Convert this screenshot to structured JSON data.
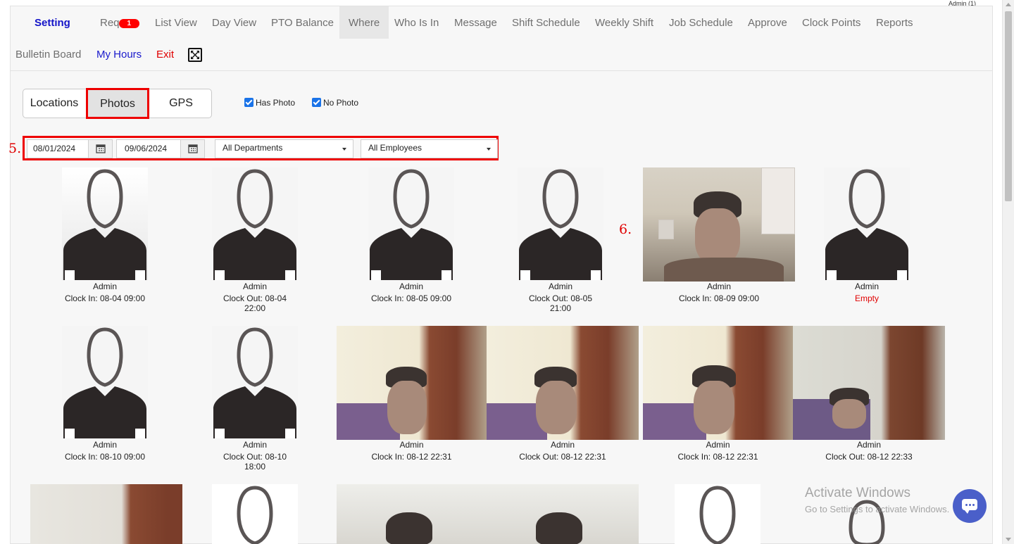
{
  "top_corner_user": "Admin (1)",
  "nav": {
    "row1": [
      {
        "label": "Setting",
        "name": "nav-setting"
      },
      {
        "label": "Req",
        "name": "nav-requests",
        "badge": "1"
      },
      {
        "label": "List View",
        "name": "nav-list-view"
      },
      {
        "label": "Day View",
        "name": "nav-day-view"
      },
      {
        "label": "PTO Balance",
        "name": "nav-pto-balance"
      },
      {
        "label": "Where",
        "name": "nav-where"
      },
      {
        "label": "Who Is In",
        "name": "nav-who-is-in"
      },
      {
        "label": "Message",
        "name": "nav-message"
      },
      {
        "label": "Shift Schedule",
        "name": "nav-shift-schedule"
      },
      {
        "label": "Weekly Shift",
        "name": "nav-weekly-shift"
      },
      {
        "label": "Job Schedule",
        "name": "nav-job-schedule"
      },
      {
        "label": "Approve",
        "name": "nav-approve"
      },
      {
        "label": "Clock Points",
        "name": "nav-clock-points"
      },
      {
        "label": "Reports",
        "name": "nav-reports"
      }
    ],
    "row2": [
      {
        "label": "Bulletin Board",
        "name": "nav-bulletin-board"
      },
      {
        "label": "My Hours",
        "name": "nav-my-hours"
      },
      {
        "label": "Exit",
        "name": "nav-exit"
      }
    ],
    "active": "Where"
  },
  "view_tabs": [
    {
      "label": "Locations"
    },
    {
      "label": "Photos",
      "selected": true
    },
    {
      "label": "GPS"
    }
  ],
  "filters_checkboxes": {
    "has_photo": {
      "label": "Has Photo",
      "checked": true
    },
    "no_photo": {
      "label": "No Photo",
      "checked": true
    }
  },
  "markers": {
    "step5": "5.",
    "step6": "6."
  },
  "filters": {
    "start_date": "08/01/2024",
    "end_date": "09/06/2024",
    "department": "All Departments",
    "employee": "All Employees"
  },
  "photos": [
    {
      "name": "Admin",
      "clock": "Clock In: 08-04 09:00",
      "has_photo": false
    },
    {
      "name": "Admin",
      "clock": "Clock Out: 08-04 22:00",
      "has_photo": false
    },
    {
      "name": "Admin",
      "clock": "Clock In: 08-05 09:00",
      "has_photo": false
    },
    {
      "name": "Admin",
      "clock": "Clock Out: 08-05 21:00",
      "has_photo": false
    },
    {
      "name": "Admin",
      "clock": "Clock In: 08-09 09:00",
      "has_photo": true
    },
    {
      "name": "Admin",
      "clock": "Empty",
      "has_photo": false
    },
    {
      "name": "Admin",
      "clock": "Clock In: 08-10 09:00",
      "has_photo": false
    },
    {
      "name": "Admin",
      "clock": "Clock Out: 08-10 18:00",
      "has_photo": false
    },
    {
      "name": "Admin",
      "clock": "Clock In: 08-12 22:31",
      "has_photo": true
    },
    {
      "name": "Admin",
      "clock": "Clock Out: 08-12 22:31",
      "has_photo": true
    },
    {
      "name": "Admin",
      "clock": "Clock In: 08-12 22:31",
      "has_photo": true
    },
    {
      "name": "Admin",
      "clock": "Clock Out: 08-12 22:33",
      "has_photo": true
    }
  ],
  "watermark": {
    "line1": "Activate Windows",
    "line2": "Go to Settings to activate Windows."
  },
  "colors": {
    "accent_red": "#ee0000",
    "link_blue": "#1a1acc",
    "chat_button": "#4a5fc9"
  }
}
